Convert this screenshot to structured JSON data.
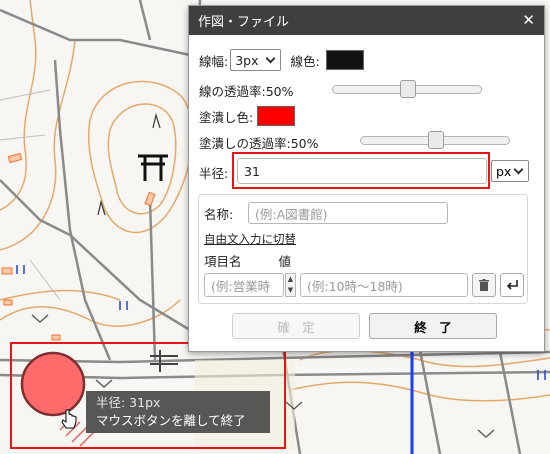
{
  "dialog": {
    "title": "作図・ファイル",
    "close_glyph": "✕",
    "line_width_label": "線幅:",
    "line_width_value": "3px",
    "line_color_label": "線色:",
    "line_color": "#111111",
    "line_opacity_label": "線の透過率:50%",
    "line_opacity": 0.5,
    "fill_color_label": "塗潰し色:",
    "fill_color": "#ff0000",
    "fill_opacity_label": "塗潰しの透過率:50%",
    "fill_opacity": 0.5,
    "radius_label": "半径:",
    "radius_value": "31",
    "radius_unit": "px",
    "name_label": "名称:",
    "name_placeholder": "(例:A図書館)",
    "free_text_link": "自由文入力に切替",
    "item_name_header": "項目名",
    "value_header": "値",
    "item_placeholder": "(例:営業時",
    "value_placeholder": "(例:10時～18時)",
    "trash_icon": "trash-icon",
    "enter_icon": "enter-icon",
    "confirm_button": "確　定",
    "finish_button": "終　了"
  },
  "tooltip": {
    "line1": "半径: 31px",
    "line2": "マウスボタンを離して終了"
  },
  "map": {
    "torii_icon": "torii-shrine-icon",
    "circle_fill": "#ff6a6a",
    "circle_stroke": "#7a3030"
  }
}
